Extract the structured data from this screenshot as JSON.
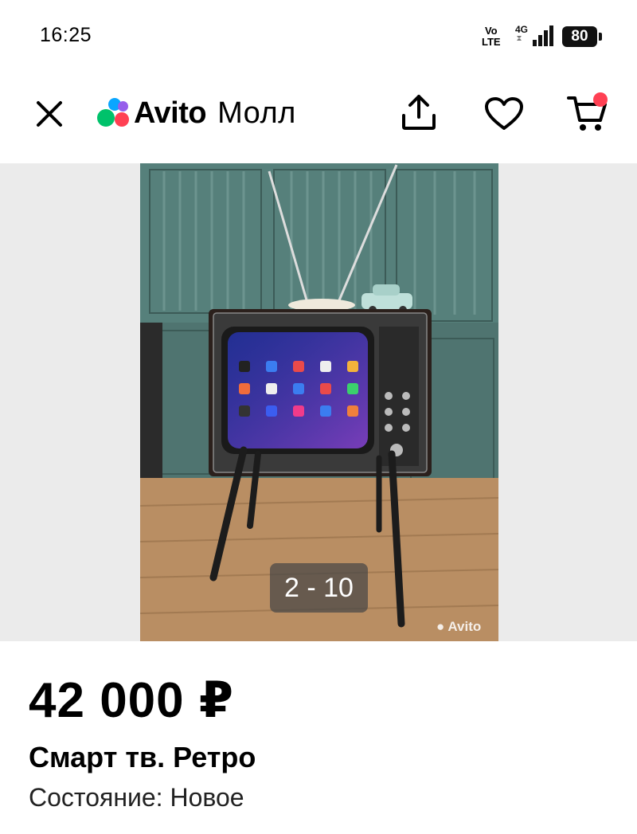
{
  "status_bar": {
    "time": "16:25",
    "network_top": "Vo",
    "network_bottom": "LTE",
    "signal_label": "4G",
    "battery": "80"
  },
  "top_bar": {
    "logo_text": "Avito",
    "logo_sub": "Молл",
    "icons": [
      "close-icon",
      "share-icon",
      "heart-icon",
      "cart-icon"
    ],
    "cart_badge_color": "#ff4053"
  },
  "gallery": {
    "counter": "2 - 10",
    "watermark": "Avito"
  },
  "listing": {
    "price": "42 000 ₽",
    "title": "Смарт тв. Ретро",
    "condition_label": "Состояние:",
    "condition_value": "Новое"
  },
  "colors": {
    "logo_green": "#00c26b",
    "logo_blue": "#0aa6ff",
    "logo_purple": "#965eeb",
    "logo_red": "#ff4053"
  }
}
